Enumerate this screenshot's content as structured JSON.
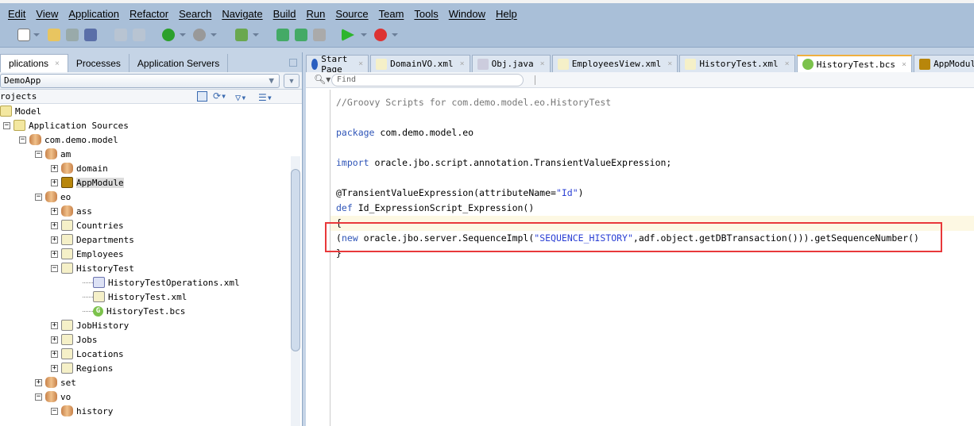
{
  "menu": [
    "Edit",
    "View",
    "Application",
    "Refactor",
    "Search",
    "Navigate",
    "Build",
    "Run",
    "Source",
    "Team",
    "Tools",
    "Window",
    "Help"
  ],
  "left_panel": {
    "tabs": [
      "plications",
      "Processes",
      "Application Servers"
    ],
    "application": "DemoApp",
    "projects_label": "rojects",
    "tree": [
      {
        "label": "Model",
        "level": 0,
        "icon": "project-icon"
      },
      {
        "label": "Application Sources",
        "level": 1,
        "icon": "folder-icon",
        "expanded": true
      },
      {
        "label": "com.demo.model",
        "level": 2,
        "icon": "package-icon",
        "expanded": true
      },
      {
        "label": "am",
        "level": 3,
        "icon": "package-icon",
        "expanded": true
      },
      {
        "label": "domain",
        "level": 4,
        "icon": "package-icon",
        "expanded": false
      },
      {
        "label": "AppModule",
        "level": 4,
        "icon": "app-module-icon",
        "expanded": false,
        "selected": true
      },
      {
        "label": "eo",
        "level": 3,
        "icon": "package-icon",
        "expanded": true
      },
      {
        "label": "ass",
        "level": 4,
        "icon": "package-icon",
        "expanded": false
      },
      {
        "label": "Countries",
        "level": 4,
        "icon": "entity-object-icon",
        "expanded": false
      },
      {
        "label": "Departments",
        "level": 4,
        "icon": "entity-object-icon",
        "expanded": false
      },
      {
        "label": "Employees",
        "level": 4,
        "icon": "entity-object-icon",
        "expanded": false
      },
      {
        "label": "HistoryTest",
        "level": 4,
        "icon": "entity-object-icon",
        "expanded": true
      },
      {
        "label": "HistoryTestOperations.xml",
        "level": 5,
        "icon": "xml-file-icon"
      },
      {
        "label": "HistoryTest.xml",
        "level": 5,
        "icon": "entity-object-icon"
      },
      {
        "label": "HistoryTest.bcs",
        "level": 5,
        "icon": "groovy-icon"
      },
      {
        "label": "JobHistory",
        "level": 4,
        "icon": "entity-object-icon",
        "expanded": false
      },
      {
        "label": "Jobs",
        "level": 4,
        "icon": "entity-object-icon",
        "expanded": false
      },
      {
        "label": "Locations",
        "level": 4,
        "icon": "entity-object-icon",
        "expanded": false
      },
      {
        "label": "Regions",
        "level": 4,
        "icon": "entity-object-icon",
        "expanded": false
      },
      {
        "label": "set",
        "level": 3,
        "icon": "package-icon",
        "expanded": false
      },
      {
        "label": "vo",
        "level": 3,
        "icon": "package-icon",
        "expanded": true
      },
      {
        "label": "history",
        "level": 4,
        "icon": "package-icon",
        "expanded": true
      }
    ]
  },
  "editor": {
    "tabs": [
      {
        "label": "Start Page",
        "icon": "help-icon"
      },
      {
        "label": "DomainVO.xml",
        "icon": "view-object-icon"
      },
      {
        "label": "Obj.java",
        "icon": "java-file-icon"
      },
      {
        "label": "EmployeesView.xml",
        "icon": "view-object-icon"
      },
      {
        "label": "HistoryTest.xml",
        "icon": "entity-object-icon"
      },
      {
        "label": "HistoryTest.bcs",
        "icon": "groovy-icon",
        "active": true
      },
      {
        "label": "AppModule.xml",
        "icon": "app-module-icon"
      }
    ],
    "find_placeholder": "Find",
    "code": {
      "l1": "//Groovy Scripts for com.demo.model.eo.HistoryTest",
      "l3a": "package",
      "l3b": " com.demo.model.eo",
      "l5a": "import",
      "l5b": " oracle.jbo.script.annotation.TransientValueExpression;",
      "l7a": "@TransientValueExpression(attributeName=",
      "l7b": "\"Id\"",
      "l7c": ")",
      "l8a": "def",
      "l8b": " Id_ExpressionScript_Expression()",
      "l9": "{",
      "l10a": "(",
      "l10b": "new",
      "l10c": " oracle.jbo.server.SequenceImpl(",
      "l10d": "\"SEQUENCE_HISTORY\"",
      "l10e": ",adf.object.getDBTransaction())).getSequenceNumber()",
      "l11": "}"
    }
  },
  "colors": {
    "highlight_box": "#e8383a",
    "keyword": "#2f55b8",
    "chrome": "#a9bfd8"
  }
}
